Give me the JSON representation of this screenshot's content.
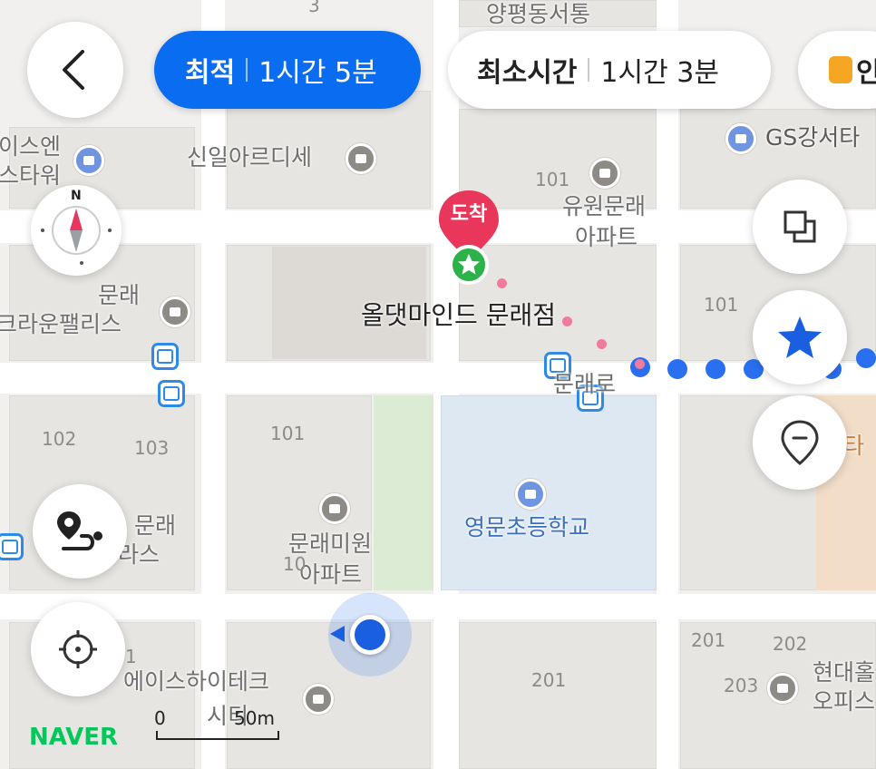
{
  "route_tabs": {
    "optimal": {
      "label": "최적",
      "duration": "1시간 5분"
    },
    "fastest": {
      "label": "최소시간",
      "duration": "1시간 3분"
    },
    "third_label": "인"
  },
  "map_labels": {
    "yangpyeong": "양평동서통",
    "sinil": "신일아르디세",
    "iscen": "이스엔",
    "tower": "스타워",
    "gs": "GS강서타",
    "yuwon": "유원문래",
    "yuwon_apt": "아파트",
    "mullae": "문래",
    "crown": "크라운팰리스",
    "road": "문래로",
    "school": "영문초등학교",
    "mire": "문래미원",
    "mire_apt": "아파트",
    "mullae_left": "문래",
    "palace_left": "라스",
    "ace": "에이스하이테크",
    "city": "시티",
    "hyundae": "현대홀",
    "office": "오피스",
    "ta": "타"
  },
  "building_numbers": {
    "n3": "3",
    "n101a": "101",
    "n101b": "101",
    "n101c": "101",
    "n102": "102",
    "n103": "103",
    "n201a": "201",
    "n202": "202",
    "n203": "203",
    "n201b": "201",
    "n1": "1",
    "n10": "10"
  },
  "destination": {
    "badge": "도착",
    "name": "올댓마인드 문래점"
  },
  "scale": {
    "zero": "0",
    "distance": "50m"
  },
  "logo": "NAVER",
  "colors": {
    "accent": "#0a6cf0",
    "destination_pin": "#e8375a",
    "logo": "#03c75a"
  }
}
